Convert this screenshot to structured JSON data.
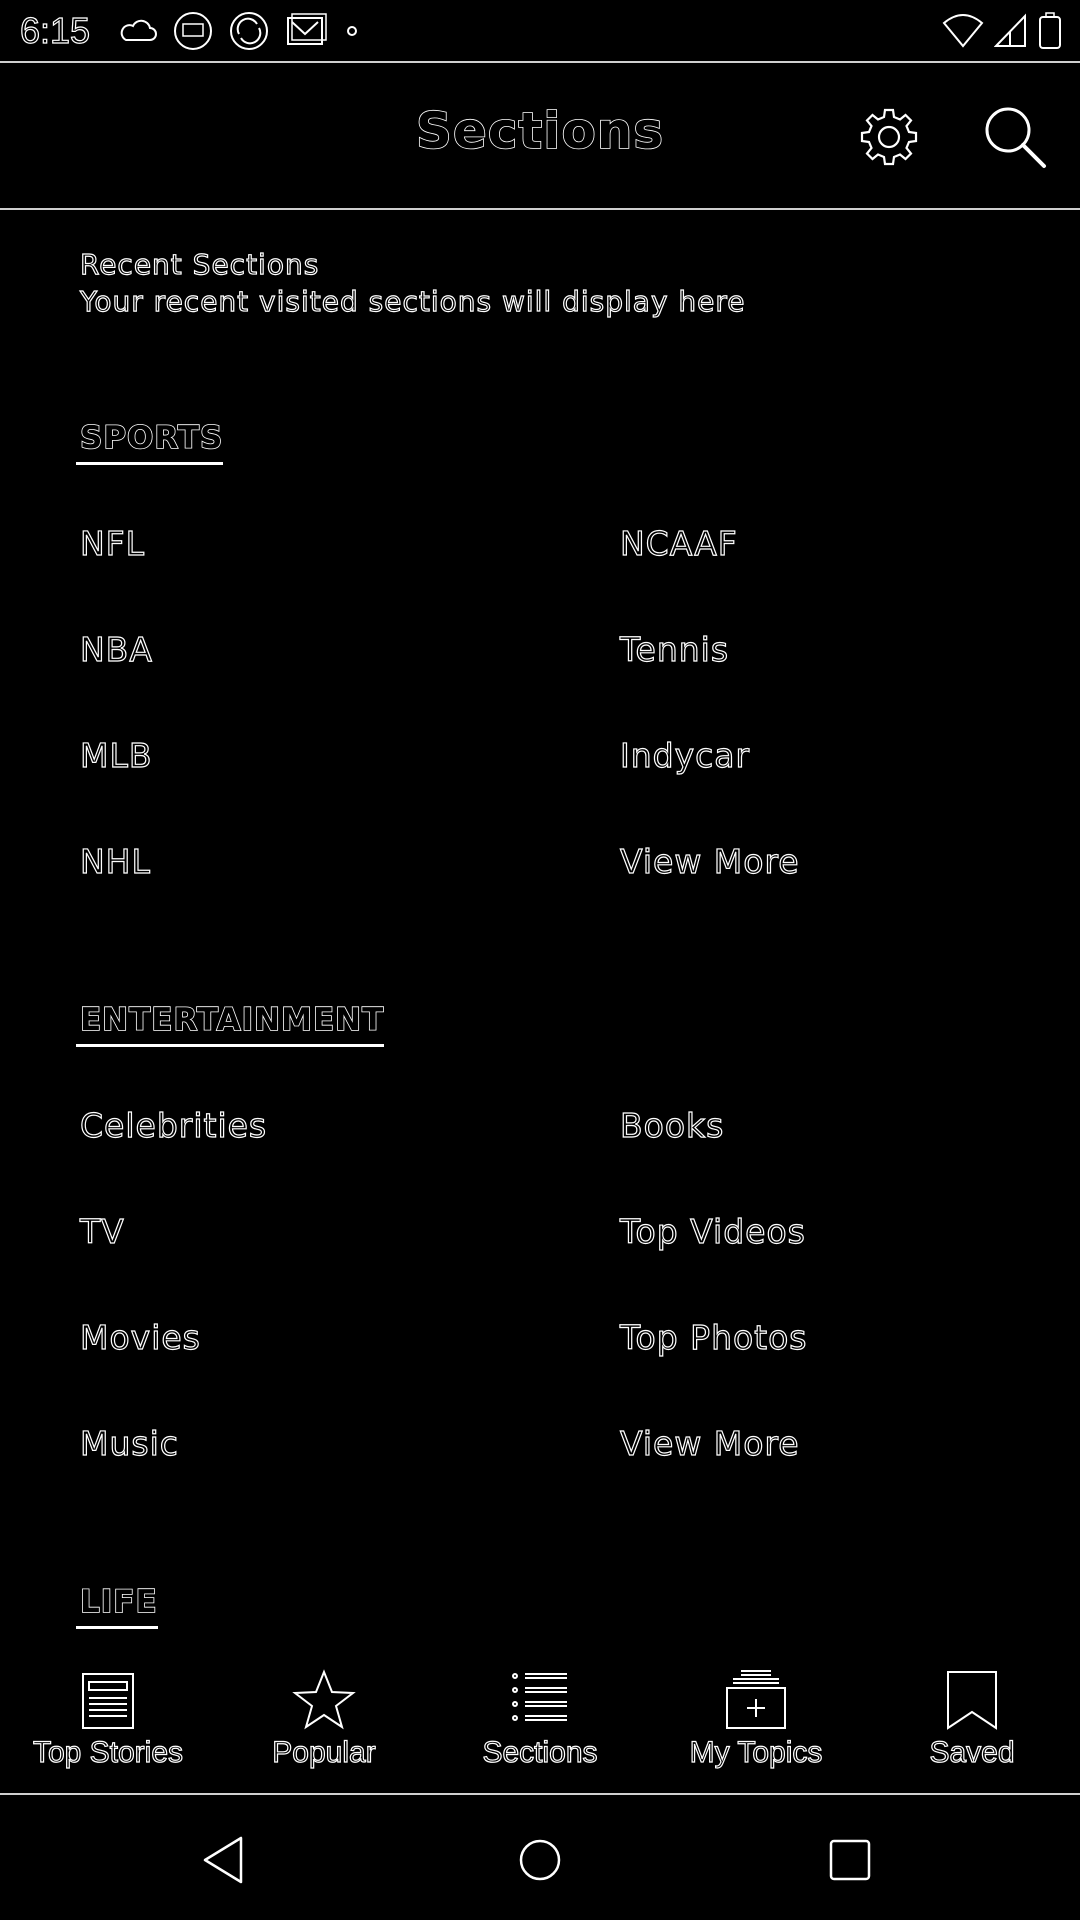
{
  "status_bar": {
    "time": "6:15",
    "left_icons": [
      "cloud-icon",
      "news-app-icon",
      "sync-app-icon",
      "mail-app-icon",
      "dot-icon"
    ],
    "right_icons": [
      "wifi-icon",
      "signal-icon",
      "battery-icon"
    ]
  },
  "app_bar": {
    "title": "Sections",
    "settings_icon": "gear-icon",
    "search_icon": "search-icon"
  },
  "recent": {
    "title": "Recent Sections",
    "subtitle": "Your recent visited sections will display here"
  },
  "sections": [
    {
      "heading": "SPORTS",
      "items": [
        "NFL",
        "NCAAF",
        "NBA",
        "Tennis",
        "MLB",
        "Indycar",
        "NHL",
        "View More"
      ]
    },
    {
      "heading": "ENTERTAINMENT",
      "items": [
        "Celebrities",
        "Books",
        "TV",
        "Top Videos",
        "Movies",
        "Top Photos",
        "Music",
        "View More"
      ]
    },
    {
      "heading": "LIFE",
      "items": []
    }
  ],
  "bottom_nav": [
    {
      "label": "Top Stories",
      "icon": "newspaper-icon",
      "selected": false
    },
    {
      "label": "Popular",
      "icon": "star-icon",
      "selected": false
    },
    {
      "label": "Sections",
      "icon": "list-icon",
      "selected": true
    },
    {
      "label": "My Topics",
      "icon": "add-topic-icon",
      "selected": false
    },
    {
      "label": "Saved",
      "icon": "bookmark-icon",
      "selected": false
    }
  ],
  "system_nav": [
    "back-icon",
    "home-icon",
    "recents-icon"
  ]
}
